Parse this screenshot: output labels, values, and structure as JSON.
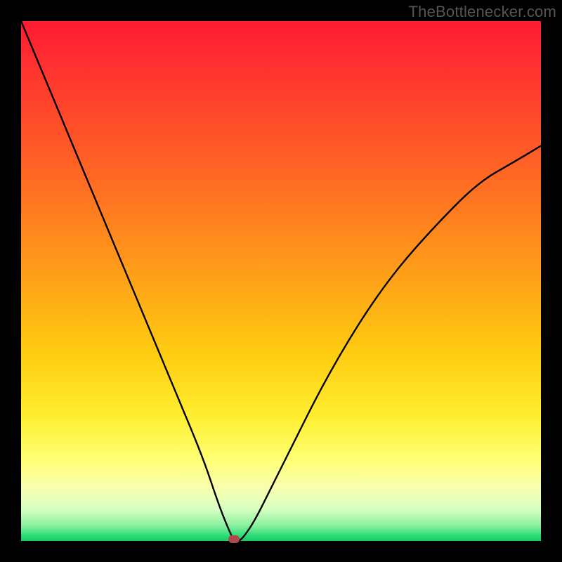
{
  "brand": {
    "label": "TheBottlenecker.com"
  },
  "chart_data": {
    "type": "line",
    "title": "",
    "xlabel": "",
    "ylabel": "",
    "xlim": [
      0,
      100
    ],
    "ylim": [
      0,
      100
    ],
    "series": [
      {
        "name": "bottleneck-curve",
        "x": [
          0,
          5,
          10,
          15,
          20,
          25,
          30,
          35,
          38,
          40,
          41,
          42,
          43,
          45,
          48,
          52,
          58,
          65,
          72,
          80,
          88,
          95,
          100
        ],
        "values": [
          100,
          88,
          76,
          64,
          52,
          40,
          28,
          16,
          7,
          2,
          0,
          0,
          1,
          4,
          10,
          18,
          30,
          42,
          52,
          61,
          69,
          73,
          76
        ]
      }
    ],
    "annotations": [
      {
        "name": "optimal-marker",
        "x": 41,
        "y": 0,
        "color": "#b04a4a"
      }
    ],
    "gradient_meaning": "red=high mismatch, green=low mismatch"
  },
  "colors": {
    "frame": "#000000",
    "curve": "#000000",
    "marker": "#b04a4a",
    "brand_text": "#555555"
  }
}
